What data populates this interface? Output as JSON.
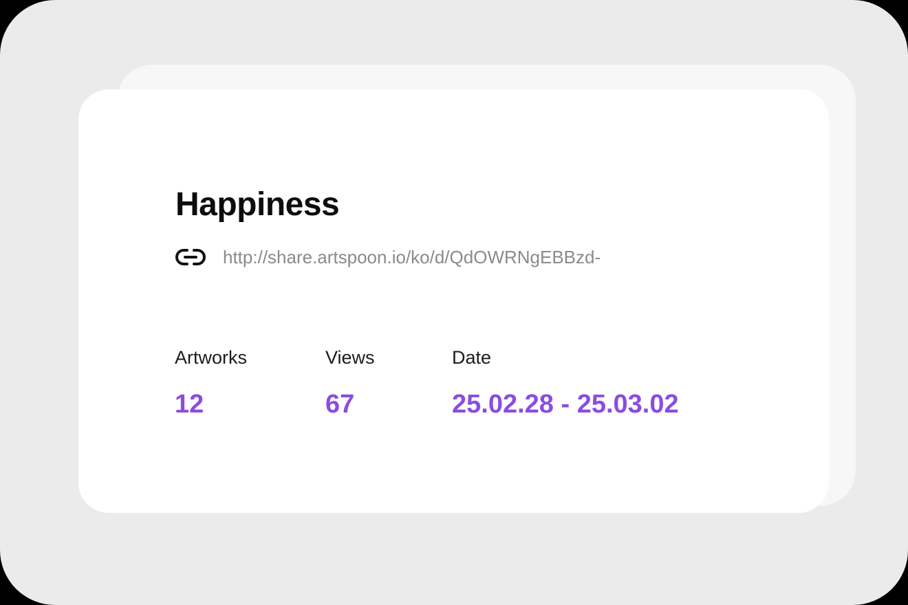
{
  "card": {
    "title": "Happiness",
    "link": {
      "icon": "link-icon",
      "url": "http://share.artspoon.io/ko/d/QdOWRNgEBBzd-"
    },
    "stats": {
      "artworks": {
        "label": "Artworks",
        "value": "12"
      },
      "views": {
        "label": "Views",
        "value": "67"
      },
      "date": {
        "label": "Date",
        "value": "25.02.28 - 25.03.02"
      }
    }
  },
  "colors": {
    "accent": "#8a4de0",
    "background": "#ebebeb",
    "card": "#ffffff",
    "muted_text": "#8a8a8a"
  }
}
